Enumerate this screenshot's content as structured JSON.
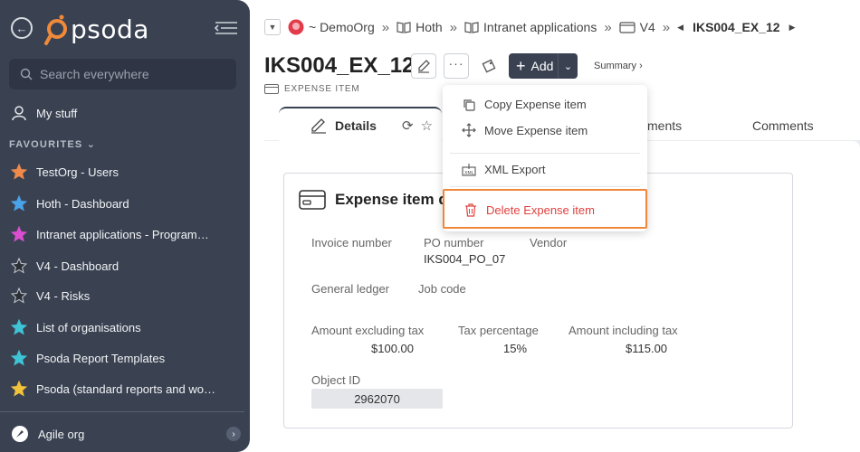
{
  "app": {
    "logo_text": "psoda"
  },
  "sidebar": {
    "search_placeholder": "Search everywhere",
    "my_stuff": "My stuff",
    "section_favourites": "FAVOURITES",
    "favourites": [
      {
        "label": "TestOrg - Users",
        "color": "#f08a4b"
      },
      {
        "label": "Hoth - Dashboard",
        "color": "#4aa3e8"
      },
      {
        "label": "Intranet applications - Programme...",
        "color": "#d94fd0"
      },
      {
        "label": "V4 - Dashboard",
        "color": "#2b2f36"
      },
      {
        "label": "V4 - Risks",
        "color": "#2b2f36"
      },
      {
        "label": "List of organisations",
        "color": "#3fc4d6"
      },
      {
        "label": "Psoda Report Templates",
        "color": "#3fc4d6"
      },
      {
        "label": "Psoda (standard reports and work...",
        "color": "#f2c23a"
      }
    ],
    "bottom_org": "Agile org"
  },
  "breadcrumb": {
    "items": [
      "~ DemoOrg",
      "Hoth",
      "Intranet applications",
      "V4"
    ],
    "current": "IKS004_EX_12"
  },
  "page": {
    "title": "IKS004_EX_12",
    "subtype": "EXPENSE ITEM",
    "add_label": "Add",
    "summary_label": "Summary ›"
  },
  "tabs": {
    "details": "Details",
    "attachments_partial": "ments",
    "comments": "Comments"
  },
  "card": {
    "title": "Expense item d",
    "fields": {
      "invoice_number": {
        "label": "Invoice number",
        "value": ""
      },
      "po_number": {
        "label": "PO number",
        "value": "IKS004_PO_07"
      },
      "vendor": {
        "label": "Vendor",
        "value": ""
      },
      "general_ledger": {
        "label": "General ledger",
        "value": ""
      },
      "job_code": {
        "label": "Job code",
        "value": ""
      },
      "amount_excl": {
        "label": "Amount excluding tax",
        "value": "$100.00"
      },
      "tax_pct": {
        "label": "Tax percentage",
        "value": "15%"
      },
      "amount_incl": {
        "label": "Amount including tax",
        "value": "$115.00"
      },
      "object_id": {
        "label": "Object ID",
        "value": "2962070"
      }
    }
  },
  "menu": {
    "copy": "Copy Expense item",
    "move": "Move Expense item",
    "xml_export": "XML Export",
    "delete": "Delete Expense item"
  },
  "colors": {
    "sidebar_bg": "#3a4252",
    "accent_orange": "#f0883a",
    "delete_red": "#e0413f"
  }
}
